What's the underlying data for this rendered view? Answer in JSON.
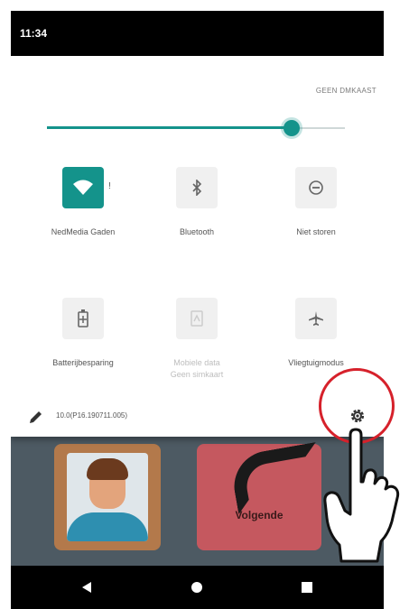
{
  "status_bar": {
    "time": "11:34"
  },
  "quick_settings": {
    "share_label": "GEEN DMKAAST",
    "brightness_level": 0.82,
    "tiles": [
      {
        "id": "wifi",
        "label": "NedMedia Gaden",
        "icon": "wifi-icon",
        "active": true,
        "badge": "!"
      },
      {
        "id": "bluetooth",
        "label": "Bluetooth",
        "icon": "bluetooth-icon",
        "active": false
      },
      {
        "id": "dnd",
        "label": "Niet storen",
        "icon": "do-not-disturb-icon",
        "active": false
      },
      {
        "id": "battery",
        "label": "Batterijbesparing",
        "icon": "battery-saver-icon",
        "active": false
      },
      {
        "id": "mobile",
        "label": "Mobiele data",
        "label2": "Geen simkaart",
        "icon": "mobile-data-icon",
        "active": false,
        "disabled": true
      },
      {
        "id": "airplane",
        "label": "Vliegtuigmodus",
        "icon": "airplane-icon",
        "active": false
      }
    ],
    "build": "10.0(P16.190711.005)"
  },
  "app": {
    "next_label": "Volgende"
  },
  "colors": {
    "accent": "#14938b",
    "highlight_circle": "#d6212b"
  }
}
